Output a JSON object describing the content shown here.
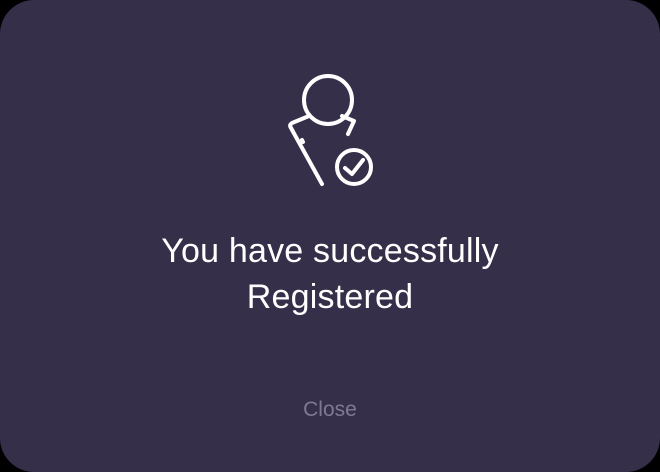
{
  "dialog": {
    "icon": "user-check-icon",
    "message_line1": "You have successfully",
    "message_line2": "Registered",
    "close_label": "Close"
  },
  "colors": {
    "background": "#352f4a",
    "text": "#ffffff",
    "muted": "#7e7a93"
  }
}
